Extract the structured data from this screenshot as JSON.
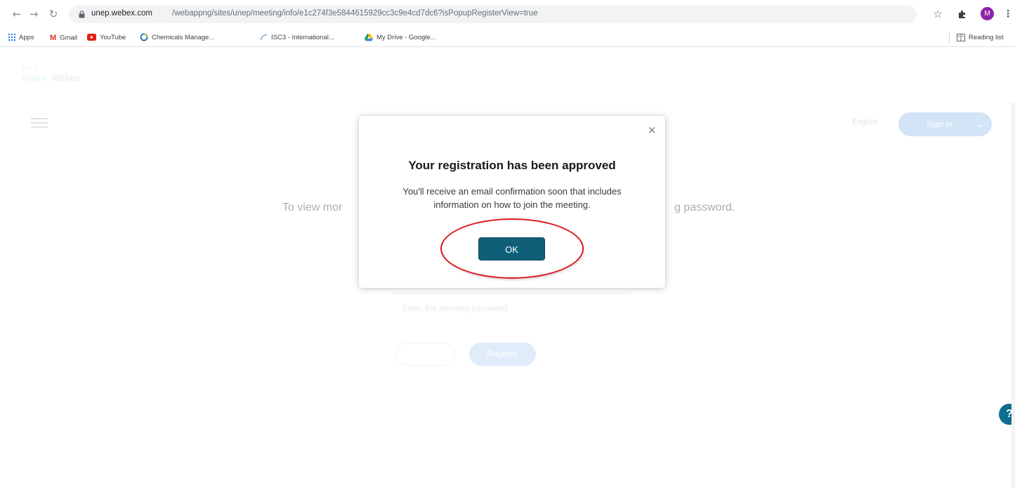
{
  "browser": {
    "url_host": "unep.webex.com",
    "url_path": "/webappng/sites/unep/meeting/info/e1c274f3e5844615929cc3c9e4cd7dc6?isPopupRegisterView=true",
    "profile_initial": "M"
  },
  "bookmarks": {
    "items": [
      {
        "label": "Apps"
      },
      {
        "label": "Gmail"
      },
      {
        "label": "YouTube"
      },
      {
        "label": "Chemicals Manage..."
      },
      {
        "label": "ISC3 - International..."
      },
      {
        "label": "My Drive - Google..."
      }
    ],
    "reading_list": "Reading list"
  },
  "page": {
    "logo_top": "cisco",
    "logo_brand": "Webex",
    "language": "English",
    "signin_label": "Sign In",
    "intro_left": "To view mor",
    "intro_right": "g password.",
    "password_placeholder": "Enter the meeting password",
    "register_label": "Register",
    "help_label": "?"
  },
  "modal": {
    "title": "Your registration has been approved",
    "message": "You'll receive an email confirmation soon that includes information on how to join the meeting.",
    "ok_label": "OK",
    "close_label": "×"
  },
  "colors": {
    "ok_button": "#0f5f79",
    "annotation": "#e0141e",
    "webex_blue": "#049fd9"
  }
}
